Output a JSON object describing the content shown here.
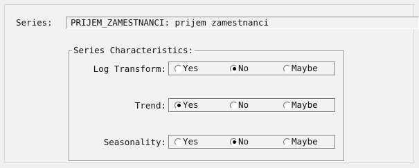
{
  "series": {
    "label": "Series:",
    "value": "PRIJEM_ZAMESTNANCI: prijem zamestnanci"
  },
  "characteristics": {
    "title": "Series Characteristics:",
    "rows": [
      {
        "label": "Log Transform:",
        "options": [
          "Yes",
          "No",
          "Maybe"
        ],
        "selected": "No"
      },
      {
        "label": "Trend:",
        "options": [
          "Yes",
          "No",
          "Maybe"
        ],
        "selected": "Yes"
      },
      {
        "label": "Seasonality:",
        "options": [
          "Yes",
          "No",
          "Maybe"
        ],
        "selected": "No"
      }
    ]
  }
}
